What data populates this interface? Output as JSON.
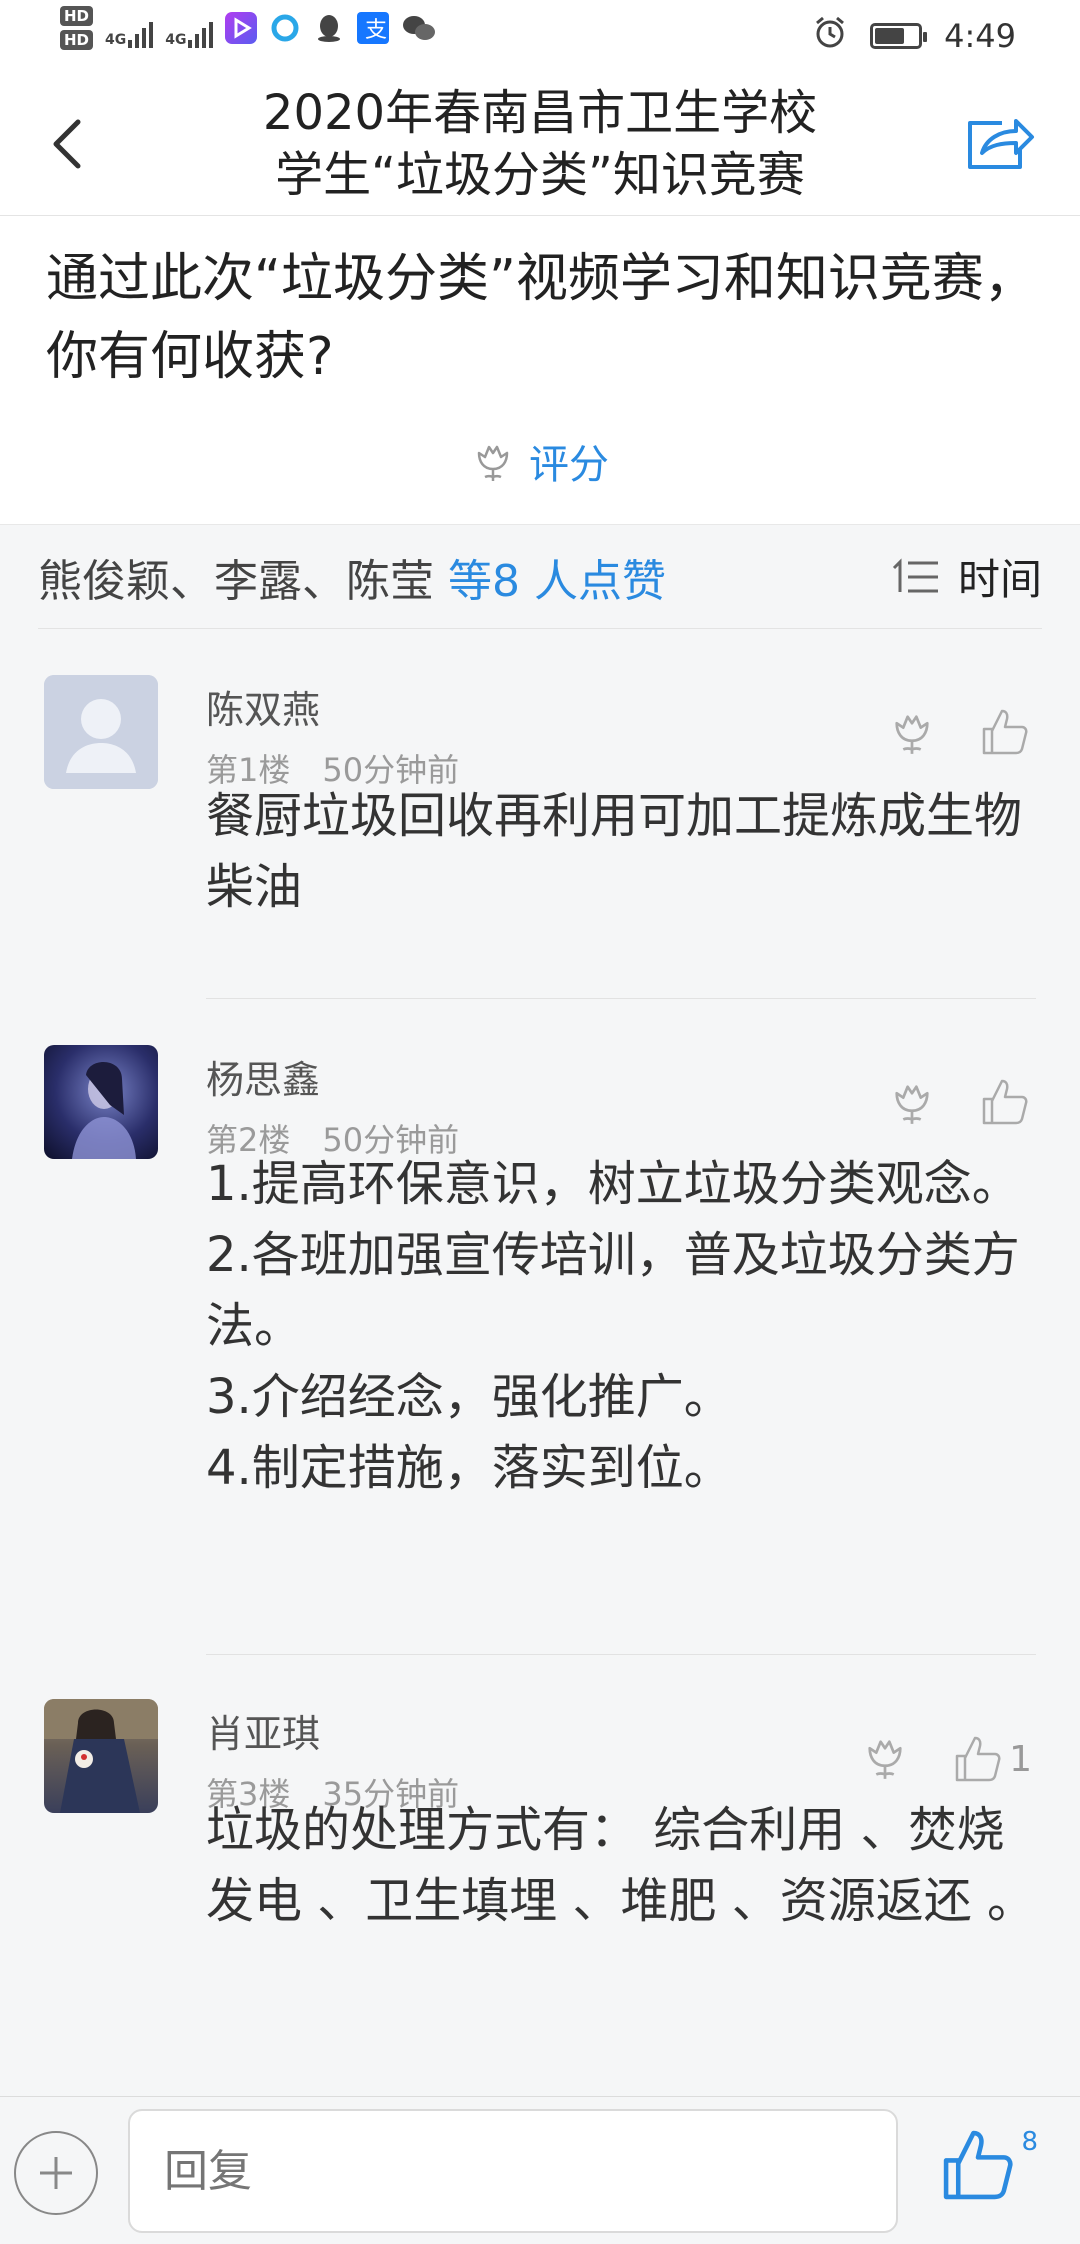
{
  "status": {
    "hd1": "HD",
    "hd2": "HD",
    "net1": "4G",
    "net2": "4G",
    "time": "4:49"
  },
  "nav": {
    "title_line1": "2020年春南昌市卫生学校",
    "title_line2": "学生“垃圾分类”知识竞赛"
  },
  "question": "通过此次“垃圾分类”视频学习和知识竞赛，你有何收获?",
  "rate_label": "评分",
  "likes": {
    "names": "熊俊颖、李露、陈莹",
    "more": "等8 人点赞"
  },
  "sort_label": "时间",
  "comments": [
    {
      "name": "陈双燕",
      "floor": "第1楼",
      "time": "50分钟前",
      "text": "餐厨垃圾回收再利用可加工提炼成生物柴油",
      "likes": ""
    },
    {
      "name": "杨思鑫",
      "floor": "第2楼",
      "time": "50分钟前",
      "lines": [
        "1.提高环保意识，树立垃圾分类观念。",
        "2.各班加强宣传培训，普及垃圾分类方法。",
        "3.介绍经念，强化推广。",
        "4.制定措施，落实到位。"
      ],
      "likes": ""
    },
    {
      "name": "肖亚琪",
      "floor": "第3楼",
      "time": "35分钟前",
      "text": "垃圾的处理方式有： 综合利用 、焚烧发电 、卫生填埋 、堆肥 、资源返还 。",
      "likes": "1"
    }
  ],
  "reply_placeholder": "回复",
  "total_likes": "8",
  "colors": {
    "accent": "#2a8ae0",
    "background": "#f5f6f7",
    "text": "#333333",
    "meta": "#9a9a9a"
  },
  "icons": [
    "back-icon",
    "share-icon",
    "flower-icon",
    "sort-icon",
    "thumb-up-icon",
    "plus-icon",
    "alarm-icon",
    "battery-icon"
  ]
}
